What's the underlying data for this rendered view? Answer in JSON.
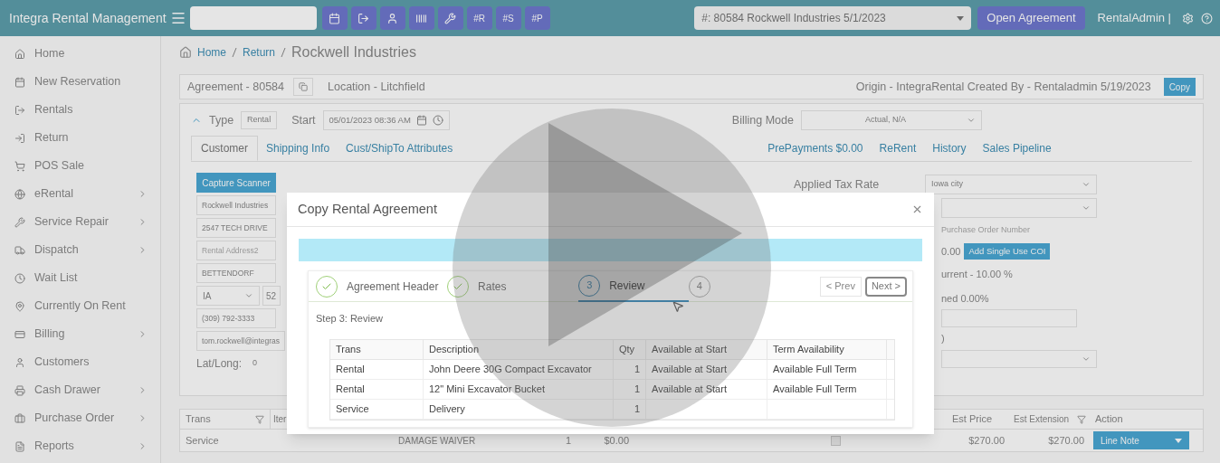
{
  "top_bar": {
    "app_title": "Integra Rental Management",
    "shortcut_buttons": [
      "#R",
      "#S",
      "#P"
    ],
    "agreement_select": "#: 80584 Rockwell Industries 5/1/2023",
    "open_button": "Open Agreement",
    "user": "RentalAdmin |"
  },
  "sidebar": {
    "items": [
      {
        "label": "Home",
        "has_submenu": false
      },
      {
        "label": "New Reservation",
        "has_submenu": false
      },
      {
        "label": "Rentals",
        "has_submenu": false
      },
      {
        "label": "Return",
        "has_submenu": false
      },
      {
        "label": "POS Sale",
        "has_submenu": false
      },
      {
        "label": "eRental",
        "has_submenu": true
      },
      {
        "label": "Service Repair",
        "has_submenu": true
      },
      {
        "label": "Dispatch",
        "has_submenu": true
      },
      {
        "label": "Wait List",
        "has_submenu": false
      },
      {
        "label": "Currently On Rent",
        "has_submenu": false
      },
      {
        "label": "Billing",
        "has_submenu": true
      },
      {
        "label": "Customers",
        "has_submenu": false
      },
      {
        "label": "Cash Drawer",
        "has_submenu": true
      },
      {
        "label": "Purchase Order",
        "has_submenu": true
      },
      {
        "label": "Reports",
        "has_submenu": true
      }
    ]
  },
  "breadcrumb": [
    "Home",
    "Return",
    "Rockwell Industries"
  ],
  "agreement_bar": {
    "agreement": "Agreement - 80584",
    "location": "Location - Litchfield",
    "origin": "Origin - IntegraRental Created By - Rentaladmin 5/19/2023",
    "copy_button": "Copy"
  },
  "header_row": {
    "type_label": "Type",
    "type_value": "Rental",
    "start_label": "Start",
    "start_value": "05/01/2023 08:36 AM",
    "billing_mode_label": "Billing Mode",
    "billing_mode_value": "Actual, N/A"
  },
  "tabs": [
    {
      "label": "Customer",
      "selected": true
    },
    {
      "label": "Shipping Info",
      "selected": false
    },
    {
      "label": "Cust/ShipTo Attributes",
      "selected": false
    },
    {
      "label": "PrePayments $0.00",
      "selected": false
    },
    {
      "label": "ReRent",
      "selected": false
    },
    {
      "label": "History",
      "selected": false
    },
    {
      "label": "Sales Pipeline",
      "selected": false
    }
  ],
  "customer": {
    "capture_button": "Capture Scanner",
    "fields": [
      {
        "kind": "text",
        "value": "Rockwell Industries"
      },
      {
        "kind": "text",
        "value": "2547 TECH DRIVE"
      },
      {
        "kind": "text",
        "placeholder": "Rental Address2"
      },
      {
        "kind": "text",
        "value": "BETTENDORF"
      },
      {
        "kind": "state",
        "value": "IA",
        "extra": "52"
      },
      {
        "kind": "text",
        "value": "(309) 792-3333"
      },
      {
        "kind": "text",
        "value": "tom.rockwell@integras"
      }
    ],
    "lat_long_label": "Lat/Long:",
    "lat_long_value": "0",
    "tax_rate_label": "Applied Tax Rate",
    "tax_rate_value": "Iowa city",
    "po_placeholder": "Purchase Order Number",
    "coi_amount": "0.00",
    "coi_button": "Add Single Use COI",
    "tax_current": "urrent - 10.00 %",
    "tax_combined": "ned 0.00%",
    "paren": ")"
  },
  "line_items": {
    "headers": {
      "trans": "Trans",
      "item": "Iter",
      "est_price": "Est Price",
      "est_extension": "Est Extension",
      "action": "Action"
    },
    "rows": [
      {
        "trans": "Service",
        "column_3": "DAMAGE WAIVER",
        "column_4": "1",
        "column_5": "$0.00",
        "checked": false,
        "est_price": "$270.00",
        "est_extension": "$270.00",
        "action": "Line Note"
      }
    ]
  },
  "dialog": {
    "title": "Copy Rental Agreement",
    "steps": [
      {
        "label": "Agreement Header",
        "completed": true,
        "selected": false
      },
      {
        "label": "Rates",
        "completed": true,
        "selected": false
      },
      {
        "number": "3",
        "label": "Review",
        "completed": false,
        "selected": true
      },
      {
        "number": "4",
        "completed": false,
        "selected": false
      }
    ],
    "prev_button": "< Prev",
    "next_button": "Next >",
    "step_title": "Step 3: Review",
    "table": {
      "columns": [
        "Trans",
        "Description",
        "Qty",
        "Available at Start",
        "Term Availability"
      ],
      "rows": [
        [
          "Rental",
          "John Deere 30G Compact Excavator",
          "1",
          "Available at Start",
          "Available Full Term"
        ],
        [
          "Rental",
          "12\" Mini Excavator Bucket",
          "1",
          "Available at Start",
          "Available Full Term"
        ],
        [
          "Service",
          "Delivery",
          "1",
          "",
          ""
        ]
      ]
    }
  }
}
